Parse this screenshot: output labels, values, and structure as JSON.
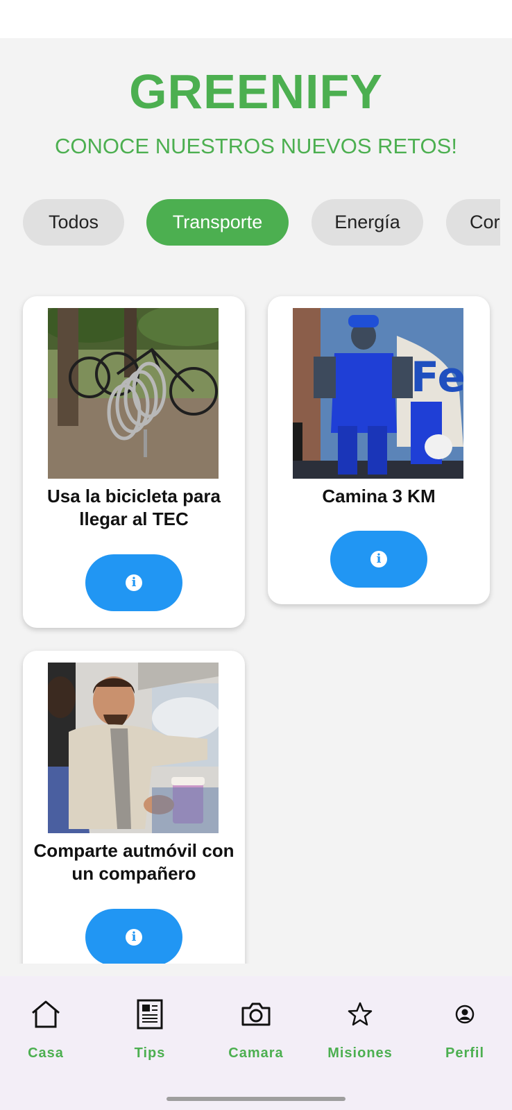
{
  "app": {
    "title": "GREENIFY",
    "subtitle": "CONOCE NUESTROS NUEVOS RETOS!"
  },
  "filters": [
    {
      "label": "Todos",
      "active": false
    },
    {
      "label": "Transporte",
      "active": true
    },
    {
      "label": "Energía",
      "active": false
    },
    {
      "label": "Cor",
      "active": false
    }
  ],
  "cards": [
    {
      "title": "Usa la bicicleta para llegar al TEC",
      "image": "bicycle-rack-photo",
      "button_icon": "info-icon"
    },
    {
      "title": "Camina 3 KM",
      "image": "runner-mannequin-photo",
      "button_icon": "info-icon"
    },
    {
      "title": "Comparte autmóvil con un compañero",
      "image": "carpool-photo",
      "button_icon": "info-icon"
    }
  ],
  "nav": [
    {
      "label": "Casa",
      "icon": "home-icon"
    },
    {
      "label": "Tips",
      "icon": "newspaper-icon"
    },
    {
      "label": "Camara",
      "icon": "camera-icon"
    },
    {
      "label": "Misiones",
      "icon": "star-icon"
    },
    {
      "label": "Perfil",
      "icon": "profile-icon"
    }
  ],
  "colors": {
    "brand_green": "#4caf50",
    "info_blue": "#2196f3",
    "chip_grey": "#e0e0e0",
    "nav_bg": "#f3eef7"
  }
}
